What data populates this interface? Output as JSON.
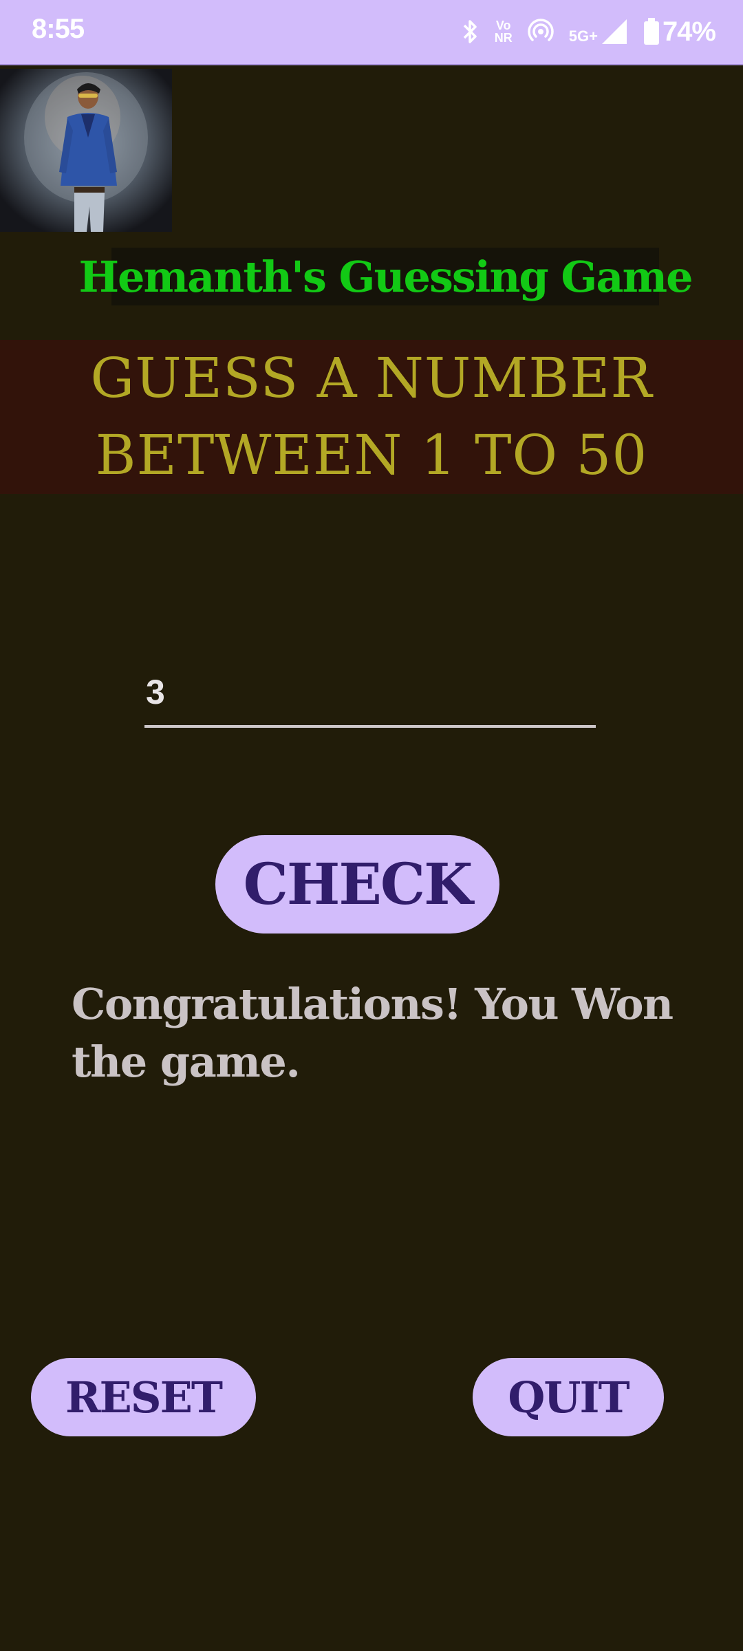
{
  "status_bar": {
    "time": "8:55",
    "volte_top": "Vo",
    "volte_bottom": "NR",
    "network": "5G+",
    "battery": "74%",
    "icons": [
      "bluetooth-icon",
      "volte-icon",
      "hotspot-icon",
      "signal-icon",
      "battery-icon"
    ]
  },
  "header": {
    "title": "Hemanth's Guessing Game"
  },
  "prompt": {
    "line1": "GUESS A NUMBER",
    "line2": "BETWEEN 1 TO 50"
  },
  "guess": {
    "value": "3"
  },
  "buttons": {
    "check": "CHECK",
    "reset": "RESET",
    "quit": "QUIT"
  },
  "result": {
    "message": "Congratulations! You Won the game."
  },
  "colors": {
    "background": "#211c09",
    "status_bar": "#d2bcfb",
    "title_text": "#12c915",
    "prompt_band": "#32130a",
    "prompt_text": "#b3a825",
    "button": "#d2bcfb",
    "button_text": "#311d6b",
    "result_text": "#cac3c5"
  }
}
